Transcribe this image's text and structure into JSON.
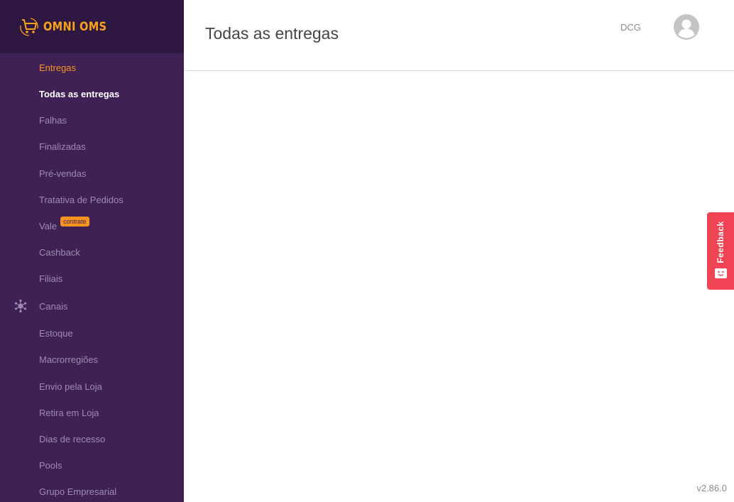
{
  "brand": {
    "name": "OMNI OMS",
    "accent_color": "#f7a21b",
    "sidebar_color": "#3f2156"
  },
  "header": {
    "title": "Todas as entregas",
    "user_code": "DCG"
  },
  "nav": {
    "section_entregas": "Entregas",
    "todas_entregas": "Todas as entregas",
    "falhas": "Falhas",
    "finalizadas": "Finalizadas",
    "pre_vendas": "Pré-vendas",
    "tratativa": "Tratativa de Pedidos",
    "vale": "Vale",
    "vale_badge": "contrate",
    "cashback": "Cashback",
    "filiais": "Filiais",
    "canais": "Canais",
    "canais_icon": "hub-icon",
    "estoque": "Estoque",
    "macrorregioes": "Macrorregiões",
    "envio_loja": "Envio pela Loja",
    "retira_loja": "Retira em Loja",
    "dias_recesso": "Dias de recesso",
    "pools": "Pools",
    "grupo_empresarial": "Grupo Empresarial"
  },
  "feedback": {
    "label": "Feedback",
    "color": "#f04455"
  },
  "footer": {
    "version": "v2.86.0"
  }
}
